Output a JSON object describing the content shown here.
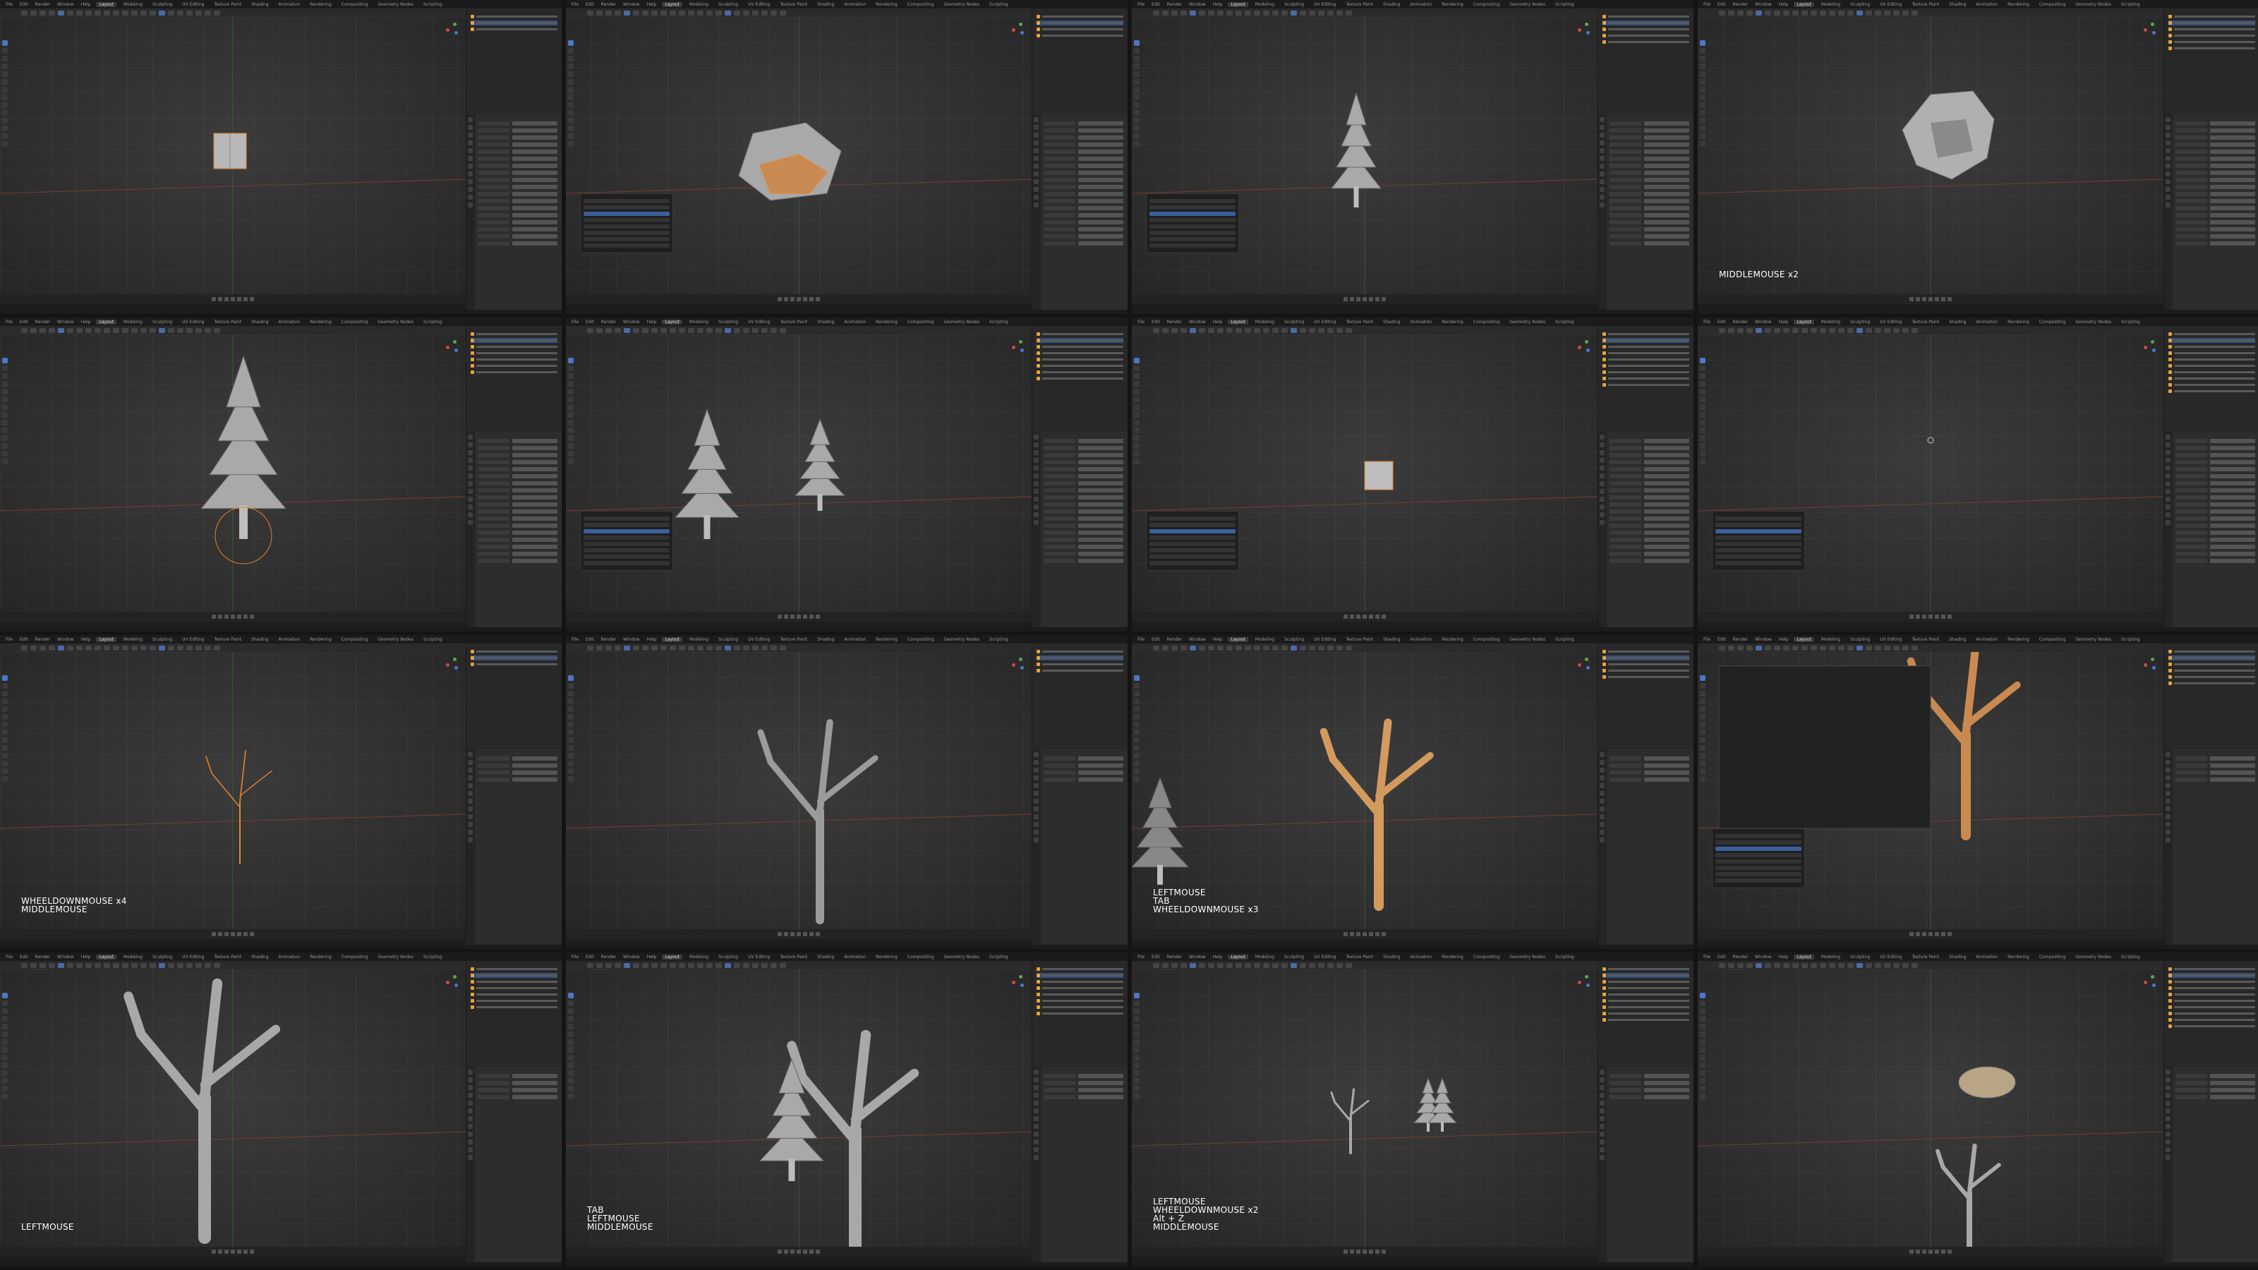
{
  "layout": {
    "columns": 4,
    "rows": 4
  },
  "topbar": {
    "menus": [
      "File",
      "Edit",
      "Render",
      "Window",
      "Help"
    ],
    "workspaces": [
      "Layout",
      "Modeling",
      "Sculpting",
      "UV Editing",
      "Texture Paint",
      "Shading",
      "Animation",
      "Rendering",
      "Compositing",
      "Geometry Nodes",
      "Scripting"
    ],
    "active_workspace": "Layout"
  },
  "panels": [
    {
      "object": "cylinder-box",
      "keys": ""
    },
    {
      "object": "rock-selected",
      "keys": ""
    },
    {
      "object": "pine-tree",
      "keys": ""
    },
    {
      "object": "round-rock",
      "keys": "MIDDLEMOUSE x2"
    },
    {
      "object": "tall-pine",
      "keys": ""
    },
    {
      "object": "two-pines",
      "keys": ""
    },
    {
      "object": "small-cube",
      "keys": ""
    },
    {
      "object": "empty",
      "keys": ""
    },
    {
      "object": "thin-branch",
      "keys": "WHEELDOWNMOUSE x4\nMIDDLEMOUSE"
    },
    {
      "object": "trunk-branches",
      "keys": ""
    },
    {
      "object": "orange-trunk",
      "keys": "LEFTMOUSE\nTAB\nWHEELDOWNMOUSE x3"
    },
    {
      "object": "trunk-with-menu",
      "keys": ""
    },
    {
      "object": "big-trunk",
      "keys": "LEFTMOUSE"
    },
    {
      "object": "trunk-and-pine",
      "keys": "TAB\nLEFTMOUSE\nMIDDLEMOUSE"
    },
    {
      "object": "distant-trees",
      "keys": "LEFTMOUSE\nWHEELDOWNMOUSE x2\nAlt + Z\nMIDDLEMOUSE"
    },
    {
      "object": "rock-and-roots",
      "keys": ""
    }
  ],
  "colors": {
    "accent": "#4b77c7",
    "selection": "#e8842a",
    "mesh": "#a9a9a9"
  }
}
